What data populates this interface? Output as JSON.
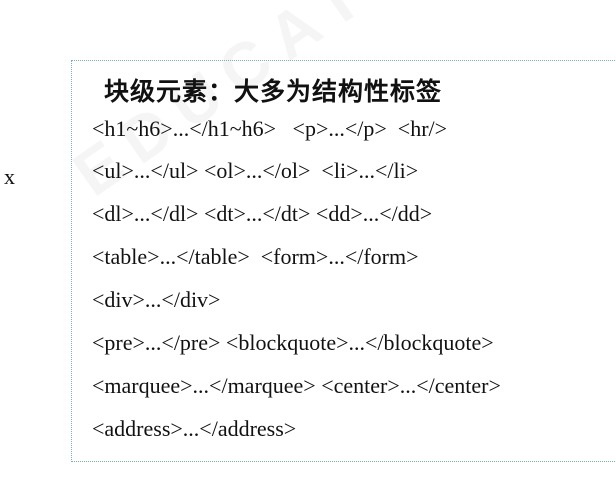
{
  "side_fragment": "x",
  "title": "块级元素：大多为结构性标签",
  "lines": [
    "<h1~h6>...</h1~h6>   <p>...</p>  <hr/>",
    "<ul>...</ul> <ol>...</ol>  <li>...</li>",
    "<dl>...</dl> <dt>...</dt> <dd>...</dd>",
    "<table>...</table>  <form>...</form>",
    "<div>...</div>",
    "<pre>...</pre> <blockquote>...</blockquote>",
    "<marquee>...</marquee> <center>...</center>",
    "<address>...</address>"
  ]
}
